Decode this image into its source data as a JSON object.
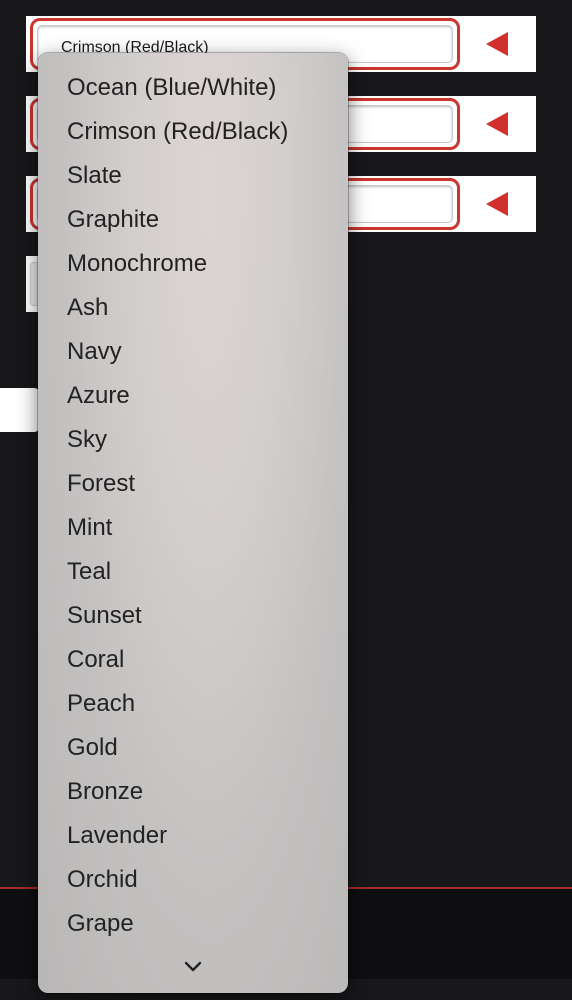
{
  "rows": [
    {
      "value": "Crimson (Red/Black)"
    },
    {
      "value": ""
    },
    {
      "value": ""
    }
  ],
  "dropdown": {
    "options": [
      "Ocean (Blue/White)",
      "Crimson (Red/Black)",
      "Slate",
      "Graphite",
      "Monochrome",
      "Ash",
      "Navy",
      "Azure",
      "Sky",
      "Forest",
      "Mint",
      "Teal",
      "Sunset",
      "Coral",
      "Peach",
      "Gold",
      "Bronze",
      "Lavender",
      "Orchid",
      "Grape"
    ]
  },
  "colors": {
    "background": "#18171a",
    "accent": "#d0312d",
    "focus_ring": "#c8362e"
  },
  "icons": {
    "row_arrow": "triangle-left-icon",
    "scroll_more": "chevron-down-icon"
  }
}
